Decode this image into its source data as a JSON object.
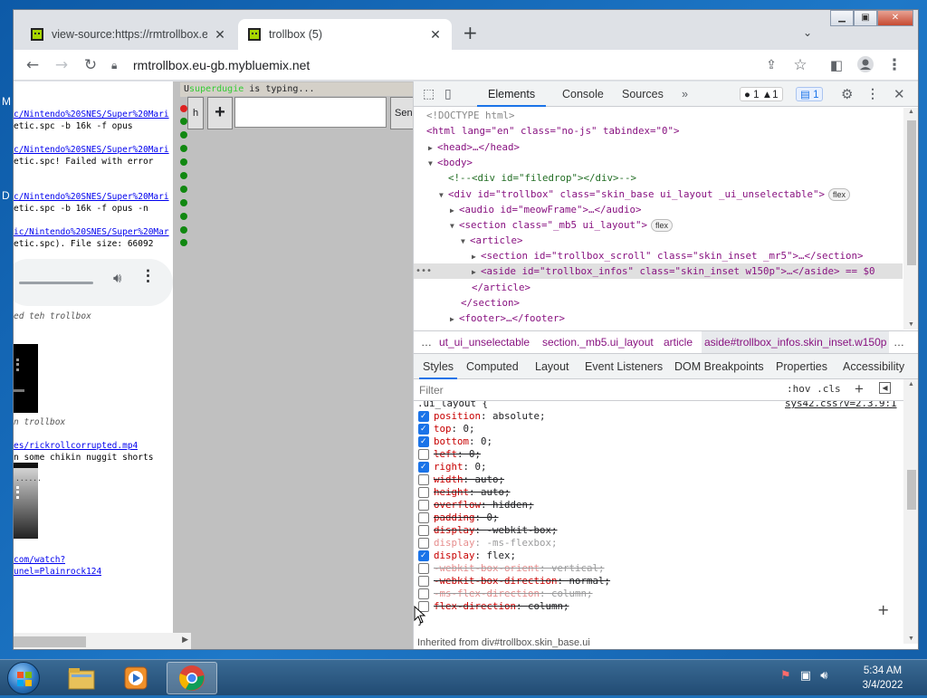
{
  "desktop": {
    "letters": [
      "M",
      "D"
    ]
  },
  "browser": {
    "tabs": [
      {
        "title": "view-source:https://rmtrollbox.eu",
        "close": "✕"
      },
      {
        "title": "trollbox (5)",
        "close": "✕"
      }
    ],
    "new_tab": "+",
    "tab_search": "⌄",
    "window_buttons": {
      "minimize": "▁",
      "maximize": "▣",
      "close": "✕"
    },
    "url": "rmtrollbox.eu-gb.mybluemix.net"
  },
  "page": {
    "chat_lines": [
      {
        "text": "c/Nintendo%20SNES/Super%20Mari",
        "link": true
      },
      {
        "text": "etic.spc -b 16k -f opus",
        "link": false
      },
      {
        "text": "",
        "link": false
      },
      {
        "text": "c/Nintendo%20SNES/Super%20Mari",
        "link": true
      },
      {
        "text": "etic.spc! Failed with error",
        "link": false
      },
      {
        "text": "",
        "link": false
      },
      {
        "text": "c/Nintendo%20SNES/Super%20Mari",
        "link": true
      },
      {
        "text": "etic.spc -b 16k -f opus -n",
        "link": false
      },
      {
        "text": "",
        "link": false
      },
      {
        "text": "ic/Nintendo%20SNES/Super%20Mar",
        "link": true
      },
      {
        "text": "etic.spc). File size: 66092",
        "link": false
      }
    ],
    "notice_1": "ed teh trollbox",
    "notice_2": "n trollbox",
    "link_mp4": "es/rickrollcorrupted.mp4",
    "chikin": "n some chikin nuggit shorts",
    "dots_text": "......",
    "link_watch_1": "com/watch?",
    "link_watch_2": "unel=Plainrock124",
    "typing_prefix": "U",
    "typing_nick": "superdugie",
    "typing_text": " is typing...",
    "btn_h": "h",
    "btn_plus": "+",
    "btn_send": "Send",
    "message_value": ""
  },
  "devtools": {
    "tabs": [
      "Elements",
      "Console",
      "Sources"
    ],
    "more": "»",
    "errors": "1",
    "warnings": "1",
    "messages": "1",
    "dom_lines": [
      {
        "indent": 0,
        "html": "<!DOCTYPE html>"
      },
      {
        "indent": 0,
        "html": "<html lang=\"en\" class=\"no-js\" tabindex=\"0\">"
      },
      {
        "indent": 1,
        "html": "<head>…</head>"
      },
      {
        "indent": 1,
        "html": "<body>"
      },
      {
        "indent": 2,
        "html": "<!--<div id=\"filedrop\"></div>-->"
      },
      {
        "indent": 2,
        "html": "<div id=\"trollbox\" class=\"skin_base ui_layout _ui_unselectable\">"
      },
      {
        "indent": 3,
        "html": "<audio id=\"meowFrame\">…</audio>"
      },
      {
        "indent": 3,
        "html": "<section class=\"_mb5 ui_layout\">"
      },
      {
        "indent": 4,
        "html": "<article>"
      },
      {
        "indent": 5,
        "html": "<section id=\"trollbox_scroll\" class=\"skin_inset _mr5\">…</section>"
      },
      {
        "indent": 5,
        "html": "<aside id=\"trollbox_infos\" class=\"skin_inset w150p\">…</aside> == $0"
      },
      {
        "indent": 4,
        "html": "</article>"
      },
      {
        "indent": 3,
        "html": "</section>"
      },
      {
        "indent": 3,
        "html": "<footer>…</footer>"
      }
    ],
    "flex_badge": "flex",
    "breadcrumbs": [
      "…",
      "ut_ui_unselectable",
      "section._mb5.ui_layout",
      "article",
      "aside#trollbox_infos.skin_inset.w150p",
      "…"
    ],
    "subtabs": [
      "Styles",
      "Computed",
      "Layout",
      "Event Listeners",
      "DOM Breakpoints",
      "Properties",
      "Accessibility"
    ],
    "filter_placeholder": "Filter",
    "hov_cls": ":hov  .cls",
    "selector": ".ui_layout {",
    "source_link": "sys42.css?v=2.3.9:1",
    "rules": [
      {
        "name": "position",
        "value": "absolute;",
        "checked": true,
        "struck": false,
        "dim": false
      },
      {
        "name": "top",
        "value": "0;",
        "checked": true,
        "struck": false,
        "dim": false
      },
      {
        "name": "bottom",
        "value": "0;",
        "checked": true,
        "struck": false,
        "dim": false
      },
      {
        "name": "left",
        "value": "0;",
        "checked": false,
        "struck": true,
        "dim": false
      },
      {
        "name": "right",
        "value": "0;",
        "checked": true,
        "struck": false,
        "dim": false
      },
      {
        "name": "width",
        "value": "auto;",
        "checked": false,
        "struck": true,
        "dim": false
      },
      {
        "name": "height",
        "value": "auto;",
        "checked": false,
        "struck": true,
        "dim": false
      },
      {
        "name": "overflow",
        "value": "hidden;",
        "checked": false,
        "struck": true,
        "dim": false
      },
      {
        "name": "padding",
        "value": "0;",
        "checked": false,
        "struck": true,
        "dim": false
      },
      {
        "name": "display",
        "value": "-webkit-box;",
        "checked": false,
        "struck": true,
        "dim": false
      },
      {
        "name": "display",
        "value": "-ms-flexbox;",
        "checked": false,
        "struck": false,
        "dim": true
      },
      {
        "name": "display",
        "value": "flex;",
        "checked": true,
        "struck": false,
        "dim": false
      },
      {
        "name": "-webkit-box-orient",
        "value": "vertical;",
        "checked": false,
        "struck": true,
        "dim": true
      },
      {
        "name": "-webkit-box-direction",
        "value": "normal;",
        "checked": false,
        "struck": true,
        "dim": false
      },
      {
        "name": "-ms-flex-direction",
        "value": "column;",
        "checked": false,
        "struck": true,
        "dim": true
      },
      {
        "name": "flex-direction",
        "value": "column;",
        "checked": false,
        "struck": true,
        "dim": false
      }
    ],
    "close_brace": "}",
    "inherited": "Inherited from div#trollbox.skin_base.ui"
  },
  "taskbar": {
    "time": "5:34 AM",
    "date": "3/4/2022"
  },
  "colors": {
    "accent": "#1a73e8",
    "online_dot": "#118811",
    "offline_dot": "#dd2222"
  }
}
